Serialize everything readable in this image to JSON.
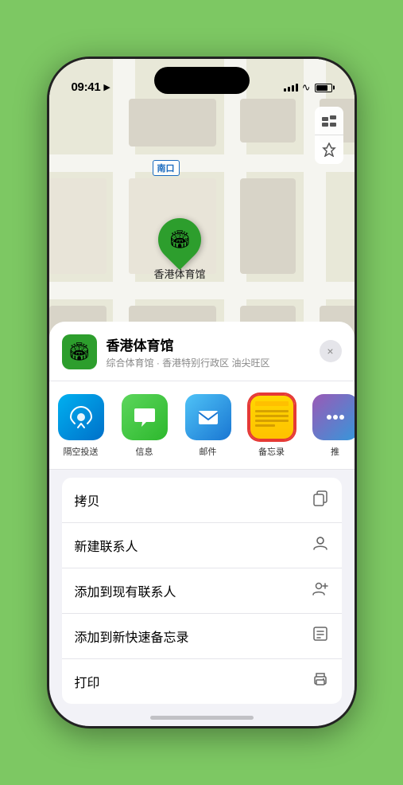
{
  "status": {
    "time": "09:41",
    "location_icon": "▶",
    "signal": [
      4,
      6,
      8,
      10,
      12
    ],
    "battery_level": "80%"
  },
  "map": {
    "label_nankou": "南口",
    "venue_label": "香港体育馆"
  },
  "map_controls": {
    "map_icon": "⊞",
    "location_icon": "⇗"
  },
  "sheet": {
    "venue_name": "香港体育馆",
    "venue_subtitle": "综合体育馆 · 香港特别行政区 油尖旺区",
    "close_label": "×"
  },
  "share_items": [
    {
      "id": "airdrop",
      "label": "隔空投送",
      "icon": "airdrop"
    },
    {
      "id": "message",
      "label": "信息",
      "icon": "message"
    },
    {
      "id": "mail",
      "label": "邮件",
      "icon": "mail"
    },
    {
      "id": "notes",
      "label": "备忘录",
      "icon": "notes"
    },
    {
      "id": "more",
      "label": "推",
      "icon": "more"
    }
  ],
  "actions": [
    {
      "id": "copy",
      "label": "拷贝",
      "icon": "copy"
    },
    {
      "id": "new-contact",
      "label": "新建联系人",
      "icon": "person"
    },
    {
      "id": "add-contact",
      "label": "添加到现有联系人",
      "icon": "person-add"
    },
    {
      "id": "quick-note",
      "label": "添加到新快速备忘录",
      "icon": "note"
    },
    {
      "id": "print",
      "label": "打印",
      "icon": "print"
    }
  ]
}
